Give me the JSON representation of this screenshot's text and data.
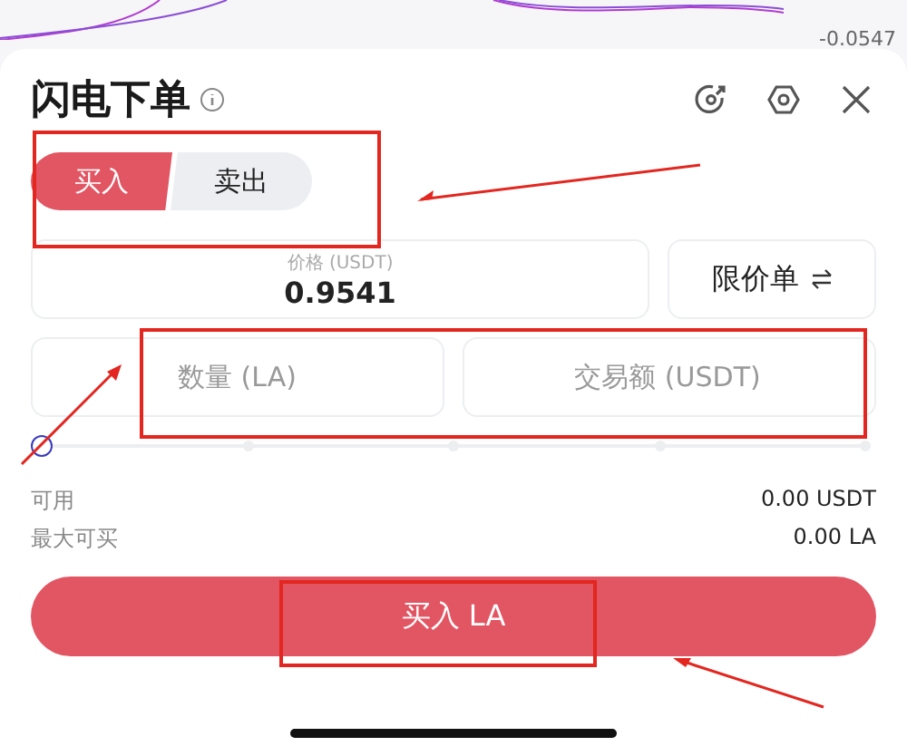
{
  "chart_edge": {
    "value_label": "-0.0547"
  },
  "sheet": {
    "title": "闪电下单",
    "sides": [
      {
        "label": "买入",
        "selected": true
      },
      {
        "label": "卖出",
        "selected": false
      }
    ],
    "price": {
      "label": "价格 (USDT)",
      "value": "0.9541"
    },
    "order_type": {
      "label": "限价单"
    },
    "amount": {
      "placeholder": "数量 (LA)"
    },
    "total": {
      "placeholder": "交易额 (USDT)"
    },
    "slider": {
      "level": 0
    },
    "info": [
      {
        "label": "可用",
        "value": "0.00 USDT"
      },
      {
        "label": "最大可买",
        "value": "0.00 LA"
      }
    ],
    "submit": {
      "label": "买入 LA"
    }
  }
}
